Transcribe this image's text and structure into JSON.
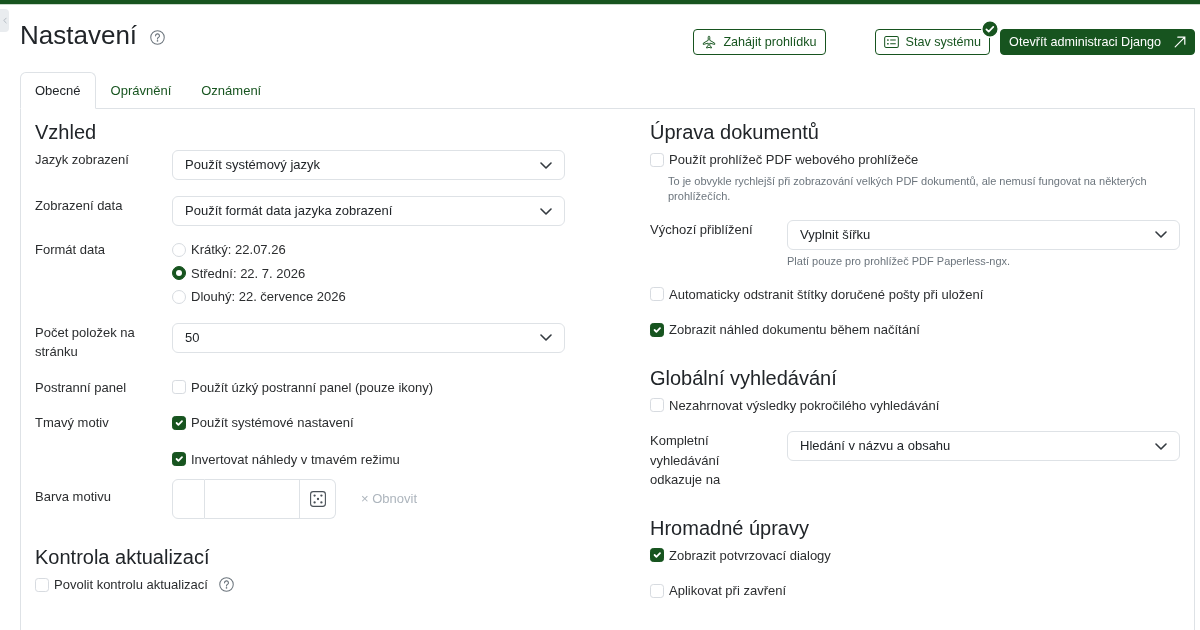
{
  "header": {
    "title": "Nastavení",
    "help": true,
    "buttons": [
      {
        "kind": "tour",
        "label": "Zahájit prohlídku"
      },
      {
        "kind": "status",
        "label": "Stav systému",
        "ok": true
      },
      {
        "kind": "admin",
        "label": "Otevřít administraci Django"
      }
    ]
  },
  "tabs": [
    {
      "label": "Obecné",
      "selected": true
    },
    {
      "label": "Oprávnění",
      "selected": false
    },
    {
      "label": "Oznámení",
      "selected": false
    }
  ],
  "columns": [
    {
      "sections": [
        {
          "heading": "Vzhled",
          "rows": [
            {
              "kind": "select",
              "label": "Jazyk zobrazení",
              "value": "Použít systémový jazyk"
            },
            {
              "kind": "select",
              "label": "Zobrazení data",
              "value": "Použít formát data jazyka zobrazení"
            },
            {
              "kind": "radio",
              "label": "Formát data",
              "options": [
                {
                  "label": "Krátký: 22.07.26",
                  "selected": false
                },
                {
                  "label": "Střední: 22. 7. 2026",
                  "selected": true
                },
                {
                  "label": "Dlouhý: 22. července 2026",
                  "selected": false
                }
              ]
            },
            {
              "kind": "select",
              "label": "Počet položek na stránku",
              "value": "50"
            },
            {
              "kind": "checks",
              "label": "Postranní panel",
              "items": [
                {
                  "label": "Použít úzký postranní panel (pouze ikony)",
                  "checked": false
                }
              ]
            },
            {
              "kind": "checks",
              "label": "Tmavý motiv",
              "items": [
                {
                  "label": "Použít systémové nastavení",
                  "checked": true
                },
                {
                  "label": "Invertovat náhledy v tmavém režimu",
                  "checked": true
                }
              ]
            },
            {
              "kind": "color",
              "label": "Barva motivu",
              "reset": {
                "label": "× Obnovit",
                "disabled": true
              }
            }
          ]
        },
        {
          "heading": "Kontrola aktualizací",
          "rows": [
            {
              "kind": "checks",
              "items": [
                {
                  "label": "Povolit kontrolu aktualizací",
                  "checked": false,
                  "help": true
                }
              ]
            }
          ]
        }
      ]
    },
    {
      "sections": [
        {
          "heading": "Úprava dokumentů",
          "rows": [
            {
              "kind": "checks",
              "items": [
                {
                  "label": "Použít prohlížeč PDF webového prohlížeče",
                  "checked": false,
                  "hint": "To je obvykle rychlejší při zobrazování velkých PDF dokumentů, ale nemusí fungovat na některých prohlížečích."
                }
              ]
            },
            {
              "kind": "select",
              "label": "Výchozí přiblížení",
              "value": "Vyplnit šířku",
              "hint": "Platí pouze pro prohlížeč PDF Paperless-ngx."
            },
            {
              "kind": "checks",
              "items": [
                {
                  "label": "Automaticky odstranit štítky doručené pošty při uložení",
                  "checked": false
                }
              ]
            },
            {
              "kind": "checks",
              "items": [
                {
                  "label": "Zobrazit náhled dokumentu během načítání",
                  "checked": true
                }
              ]
            }
          ]
        },
        {
          "heading": "Globální vyhledávání",
          "rows": [
            {
              "kind": "checks",
              "items": [
                {
                  "label": "Nezahrnovat výsledky pokročilého vyhledávání",
                  "checked": false
                }
              ]
            },
            {
              "kind": "select",
              "label": "Kompletní vyhledávání odkazuje na",
              "value": "Hledání v názvu a obsahu"
            }
          ]
        },
        {
          "heading": "Hromadné úpravy",
          "rows": [
            {
              "kind": "checks",
              "items": [
                {
                  "label": "Zobrazit potvrzovací dialogy",
                  "checked": true
                }
              ]
            },
            {
              "kind": "checks",
              "items": [
                {
                  "label": "Aplikovat při zavření",
                  "checked": false
                }
              ]
            }
          ]
        }
      ]
    }
  ]
}
